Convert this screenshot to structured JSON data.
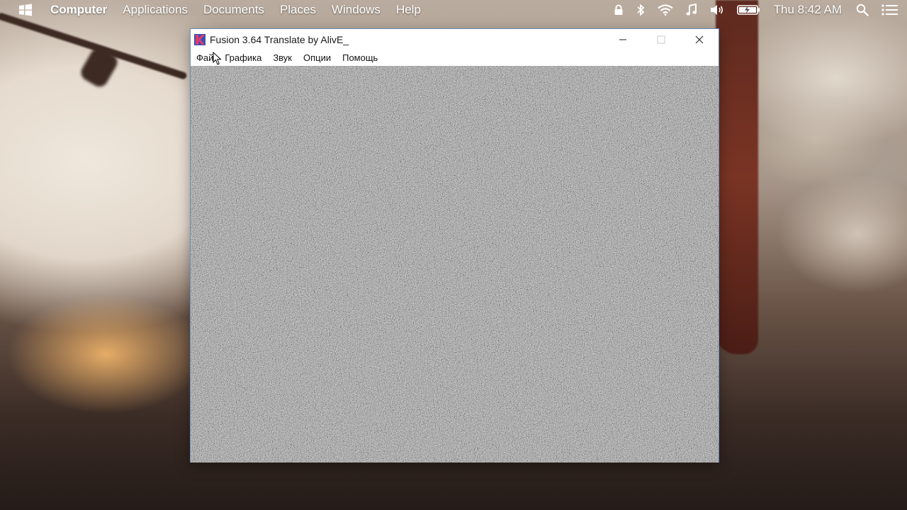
{
  "top_panel": {
    "logo_icon": "windows-logo-icon",
    "menu": [
      "Computer",
      "Applications",
      "Documents",
      "Places",
      "Windows",
      "Help"
    ],
    "tray_icons": [
      "lock-icon",
      "bluetooth-icon",
      "wifi-icon",
      "music-icon",
      "volume-icon",
      "battery-icon"
    ],
    "clock": "Thu 8:42 AM",
    "search_icon": "search-icon",
    "menu_icon": "hamburger-menu-icon"
  },
  "window": {
    "title": "Fusion 3.64 Translate by AlivE_",
    "app_icon": "kega-fusion-icon",
    "controls": [
      "minimize-icon",
      "maximize-icon",
      "close-icon"
    ],
    "menu": [
      "Фай",
      "Графика",
      "Звук",
      "Опции",
      "Помощь"
    ],
    "viewport_content": "static-noise"
  },
  "colors": {
    "panel_text": "#ffffff",
    "window_border": "#6d8fb7",
    "noise_base": "#9a9a9a"
  }
}
